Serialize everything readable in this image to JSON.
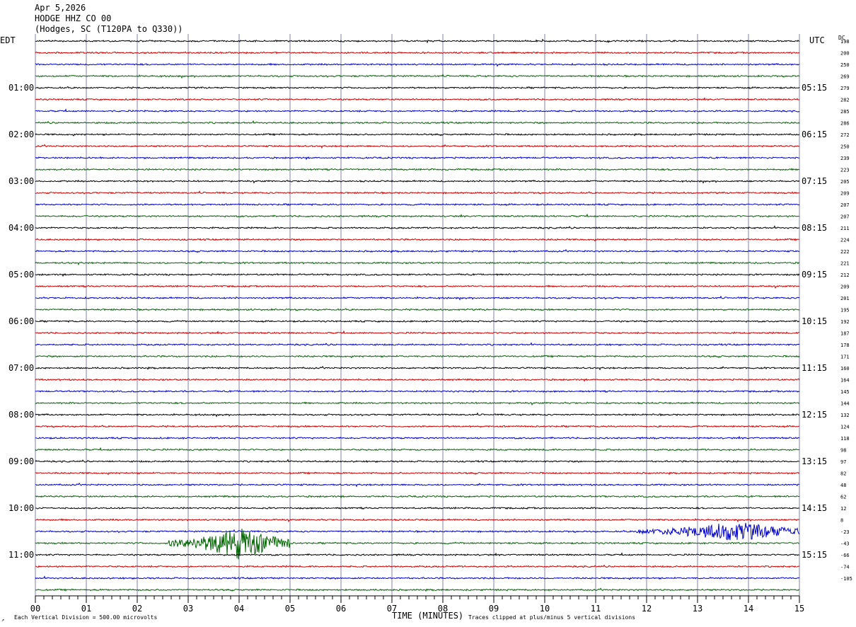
{
  "header": {
    "date": "Apr 5,2026",
    "station": "HODGE HHZ CO 00",
    "location": "(Hodges, SC (T120PA to Q330))"
  },
  "labels": {
    "left_tz": "EDT",
    "right_tz": "UTC",
    "dc": "DC",
    "x_title": "TIME (MINUTES)",
    "scale_note": "Each Vertical Division =  500.00 microvolts",
    "clip_note": "Traces clipped at plus/minus 5 vertical divisions"
  },
  "colors": {
    "black": "#000000",
    "red": "#cc0000",
    "blue": "#0000cc",
    "green": "#006600",
    "grid": "#8080b0"
  },
  "chart_data": {
    "type": "line",
    "title": "HODGE HHZ CO 00",
    "xlabel": "TIME (MINUTES)",
    "xlim": [
      0,
      15
    ],
    "x_ticks": [
      "00",
      "01",
      "02",
      "03",
      "04",
      "05",
      "06",
      "07",
      "08",
      "09",
      "10",
      "11",
      "12",
      "13",
      "14",
      "15"
    ],
    "minutes_per_row": 15,
    "rows": 48,
    "row_color_cycle": [
      "black",
      "red",
      "blue",
      "green"
    ],
    "left_time_labels": [
      "01:00",
      "02:00",
      "03:00",
      "04:00",
      "05:00",
      "06:00",
      "07:00",
      "08:00",
      "09:00",
      "10:00",
      "11:00"
    ],
    "right_time_labels": [
      "05:15",
      "06:15",
      "07:15",
      "08:15",
      "09:15",
      "10:15",
      "11:15",
      "12:15",
      "13:15",
      "14:15",
      "15:15"
    ],
    "dc_offsets": [
      "198",
      "200",
      "250",
      "269",
      "279",
      "282",
      "285",
      "286",
      "272",
      "250",
      "239",
      "223",
      "205",
      "209",
      "207",
      "207",
      "211",
      "224",
      "222",
      "221",
      "212",
      "209",
      "201",
      "195",
      "192",
      "187",
      "178",
      "171",
      "160",
      "164",
      "145",
      "144",
      "132",
      "124",
      "118",
      "98",
      "97",
      "82",
      "48",
      "62",
      "12",
      "8",
      "-23",
      "-43",
      "-66",
      "-74",
      "-105"
    ],
    "events": [
      {
        "row": 42,
        "start_min": 11.8,
        "end_min": 15.0,
        "peak_min": 13.75,
        "amplitude_div": 1.2
      },
      {
        "row": 43,
        "start_min": 2.6,
        "end_min": 5.0,
        "peak_min": 4.0,
        "amplitude_div": 2.0
      }
    ],
    "scale_microvolts_per_division": 500.0,
    "clip_divisions": 5
  }
}
